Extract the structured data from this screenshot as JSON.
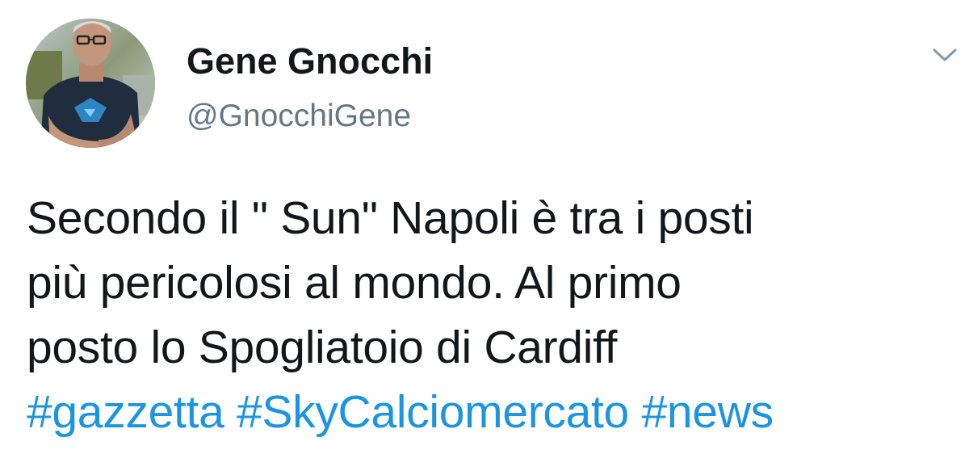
{
  "author": {
    "name": "Gene Gnocchi",
    "handle": "@GnocchiGene"
  },
  "tweet": {
    "lines": [
      "Secondo il \" Sun\" Napoli è tra i posti",
      "più pericolosi al mondo. Al primo",
      "posto lo Spogliatoio di Cardiff"
    ],
    "hashtags": [
      "#gazzetta",
      "#SkyCalciomercato",
      "#news"
    ]
  },
  "icons": {
    "more": "chevron-down-icon",
    "avatar": "avatar"
  },
  "colors": {
    "text": "#14171a",
    "handle": "#657786",
    "hashtag": "#1b95e0",
    "chevron": "#8899a6"
  }
}
